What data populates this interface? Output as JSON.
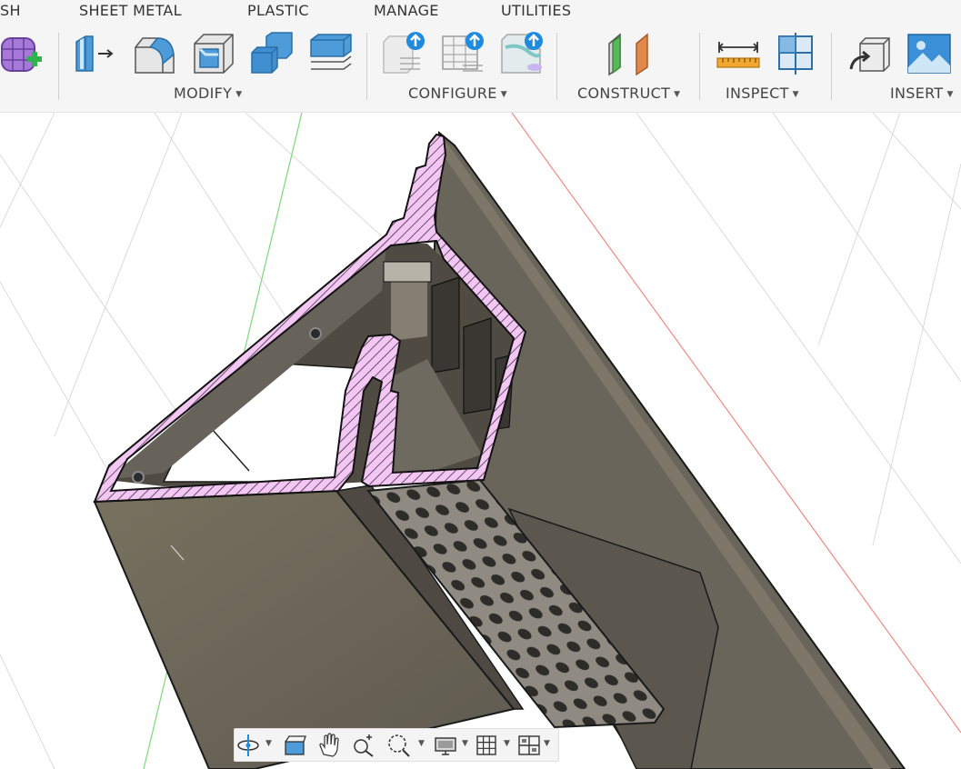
{
  "tabs": [
    "SH",
    "SHEET METAL",
    "PLASTIC",
    "MANAGE",
    "UTILITIES"
  ],
  "groups": {
    "modify": "MODIFY",
    "configure": "CONFIGURE",
    "construct": "CONSTRUCT",
    "inspect": "INSPECT",
    "insert": "INSERT"
  },
  "tools": {
    "create_form": "create-form-icon",
    "press_pull": "press-pull-icon",
    "fillet": "fillet-icon",
    "shell": "shell-icon",
    "combine": "combine-icon",
    "offset_face": "offset-face-icon",
    "configure_1": "configure-upload-icon",
    "configure_2": "configure-table-icon",
    "configure_3": "configure-theme-icon",
    "construct_plane": "offset-plane-icon",
    "measure": "measure-icon",
    "section_analysis": "section-analysis-icon",
    "insert_derive": "insert-derive-icon",
    "insert_image": "insert-image-icon"
  },
  "navigation": [
    "orbit-icon",
    "look-at-icon",
    "pan-icon",
    "zoom-icon",
    "fit-icon",
    "display-settings-icon",
    "grid-settings-icon",
    "viewports-icon"
  ],
  "colors": {
    "toolbar_bg": "#f5f5f5",
    "section_hatch": "#f3c6f3",
    "model_body": "#706a5e",
    "axis_y": "#7fd67f",
    "axis_x": "#f08a80",
    "grid": "#d8d8d8"
  }
}
